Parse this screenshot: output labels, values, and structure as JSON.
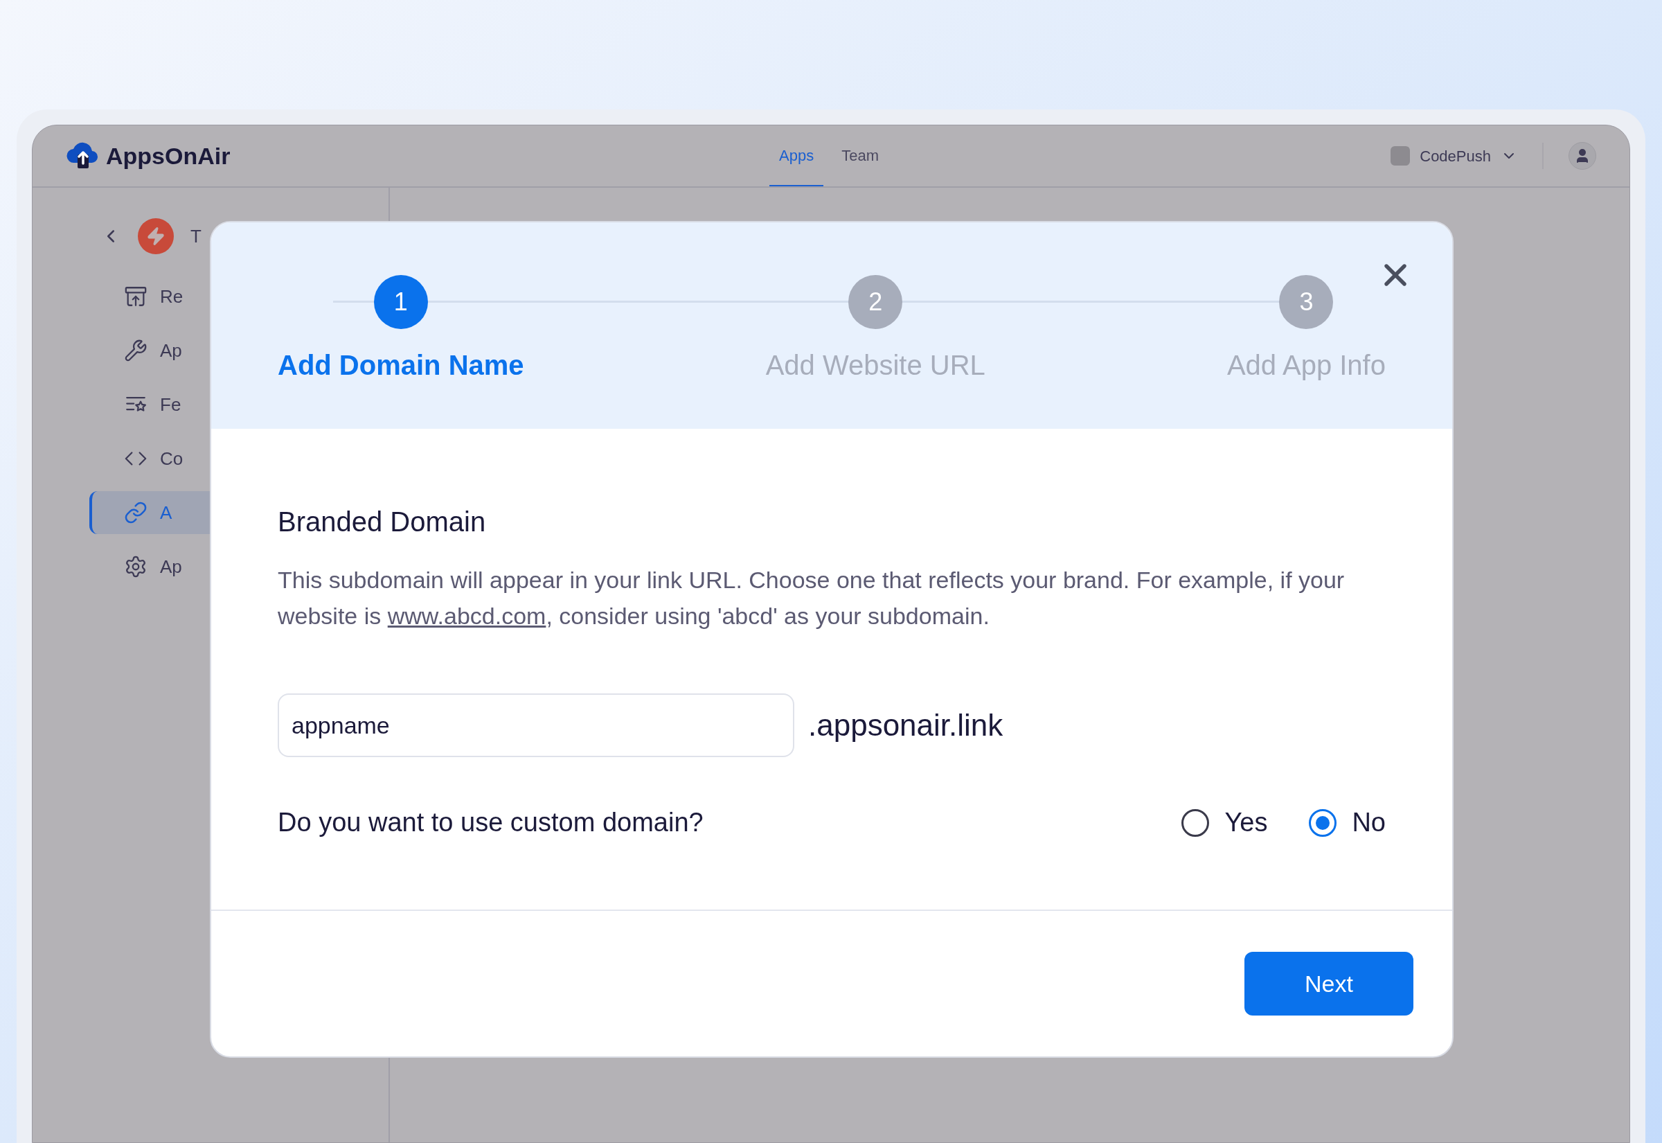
{
  "app": {
    "logo": "AppsOnAir"
  },
  "nav_tabs": [
    {
      "label": "Apps",
      "selected": true
    },
    {
      "label": "Team",
      "selected": false
    }
  ],
  "workspace": {
    "label": "CodePush"
  },
  "sidebar": {
    "app_name": "T",
    "items": [
      {
        "kind": "release",
        "label": "Re",
        "selected": false
      },
      {
        "kind": "wrench",
        "label": "Ap",
        "selected": false
      },
      {
        "kind": "features",
        "label": "Fe",
        "selected": false
      },
      {
        "kind": "code",
        "label": "Co",
        "selected": false
      },
      {
        "kind": "link",
        "label": "A",
        "selected": true
      },
      {
        "kind": "settings",
        "label": "Ap",
        "selected": false
      }
    ]
  },
  "modal": {
    "steps": [
      {
        "number": "1",
        "label": "Add Domain Name",
        "selected": true
      },
      {
        "number": "2",
        "label": "Add Website URL",
        "selected": false
      },
      {
        "number": "3",
        "label": "Add App Info",
        "selected": false
      }
    ],
    "section_title": "Branded Domain",
    "description_before": "This subdomain will appear in your link URL. Choose one that reflects your brand. For example, if your website is ",
    "link": "www.abcd.com",
    "description_after": ", consider using 'abcd' as your subdomain.",
    "subdomain": {
      "value": "appname",
      "suffix": ".appsonair.link"
    },
    "question": "Do you want to use custom domain?",
    "options": [
      {
        "label": "Yes",
        "selected": false
      },
      {
        "label": "No",
        "selected": true
      }
    ],
    "next_button": "Next"
  }
}
